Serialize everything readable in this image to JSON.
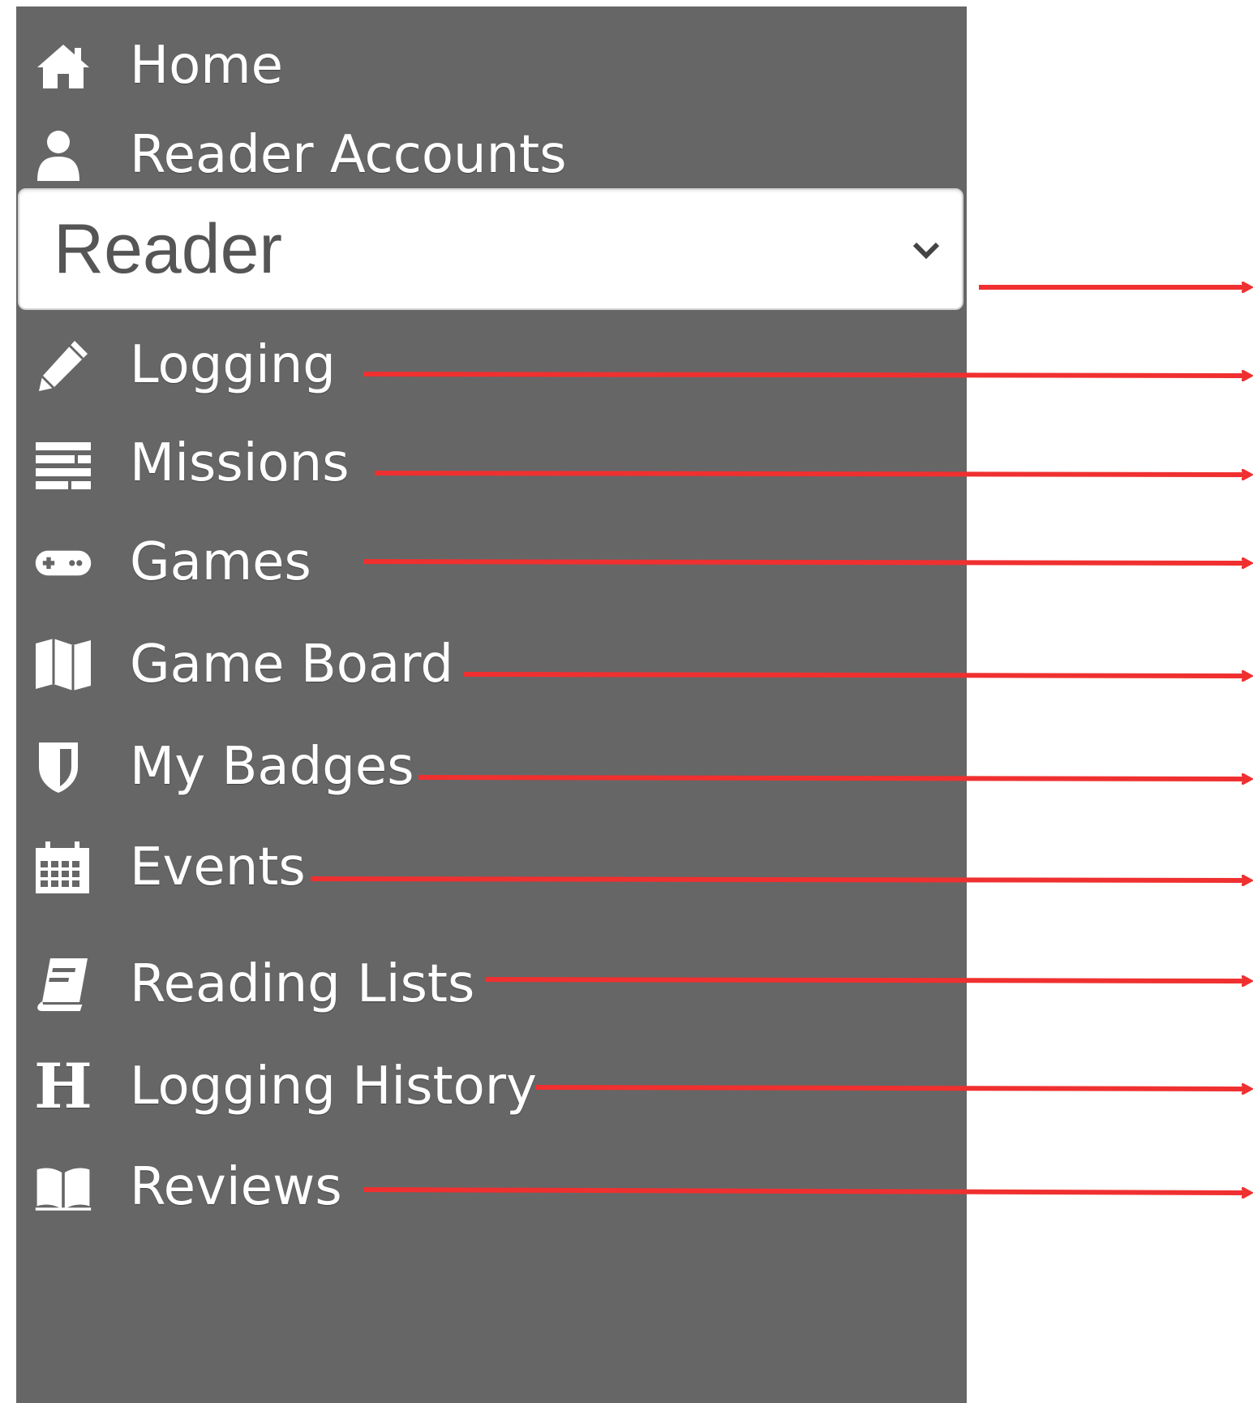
{
  "sidebar": {
    "background": "#666666",
    "items": [
      {
        "label": "Home",
        "icon": "home-icon"
      },
      {
        "label": "Reader Accounts",
        "icon": "user-icon"
      },
      {
        "label": "Logging",
        "icon": "pencil-icon"
      },
      {
        "label": "Missions",
        "icon": "list-icon"
      },
      {
        "label": "Games",
        "icon": "gamepad-icon"
      },
      {
        "label": "Game Board",
        "icon": "map-icon"
      },
      {
        "label": "My Badges",
        "icon": "shield-icon"
      },
      {
        "label": "Events",
        "icon": "calendar-icon"
      },
      {
        "label": "Reading Lists",
        "icon": "book-icon"
      },
      {
        "label": "Logging History",
        "icon": "history-h-icon"
      },
      {
        "label": "Reviews",
        "icon": "open-book-icon"
      }
    ]
  },
  "reader_select": {
    "value": "Reader",
    "icon": "chevron-down-icon"
  },
  "annotation": {
    "arrow_color": "#f03030"
  }
}
